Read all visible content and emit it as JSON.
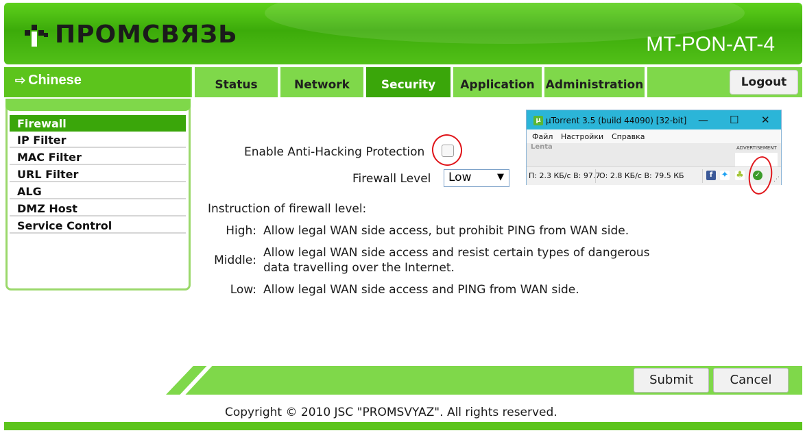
{
  "header": {
    "logo_text": "ПРОМСВЯЗЬ",
    "model": "MT-PON-AT-4",
    "colors": {
      "green_dark": "#3aa60a",
      "green_light": "#7fd84a"
    }
  },
  "nav": {
    "language_link": "Chinese",
    "tabs": [
      {
        "label": "Status"
      },
      {
        "label": "Network"
      },
      {
        "label": "Security"
      },
      {
        "label": "Application"
      },
      {
        "label": "Administration"
      }
    ],
    "active_tab": "Security",
    "logout": "Logout"
  },
  "sidebar": {
    "items": [
      {
        "label": "Firewall"
      },
      {
        "label": "IP Filter"
      },
      {
        "label": "MAC Filter"
      },
      {
        "label": "URL Filter"
      },
      {
        "label": "ALG"
      },
      {
        "label": "DMZ Host"
      },
      {
        "label": "Service Control"
      }
    ],
    "active_item": "Firewall"
  },
  "firewall": {
    "anti_hacking_label": "Enable Anti-Hacking Protection",
    "anti_hacking_checked": false,
    "level_label": "Firewall Level",
    "level_value": "Low",
    "instruction_title": "Instruction of firewall level:",
    "levels": [
      {
        "name": "High:",
        "desc": "Allow legal WAN side access, but prohibit PING from WAN side."
      },
      {
        "name": "Middle:",
        "desc_line1": "Allow legal WAN side access and resist certain types of dangerous",
        "desc_line2": "data travelling over the Internet."
      },
      {
        "name": "Low:",
        "desc": "Allow legal WAN side access and PING from WAN side."
      }
    ]
  },
  "buttons": {
    "submit": "Submit",
    "cancel": "Cancel"
  },
  "footer": {
    "copyright": "Copyright © 2010 JSC \"PROMSVYAZ\". All rights reserved."
  },
  "utorrent": {
    "title": "µTorrent 3.5  (build 44090) [32-bit]",
    "menu": [
      "Файл",
      "Настройки",
      "Справка"
    ],
    "lenta": "Lenta",
    "advertisement": "ADVERTISEMENT",
    "status_download": "П: 2.3 КБ/с В: 97.7",
    "status_upload": "О: 2.8 КБ/с В: 79.5 КБ",
    "icons": [
      "facebook-icon",
      "twitter-icon",
      "android-icon",
      "checkmark-icon"
    ]
  }
}
